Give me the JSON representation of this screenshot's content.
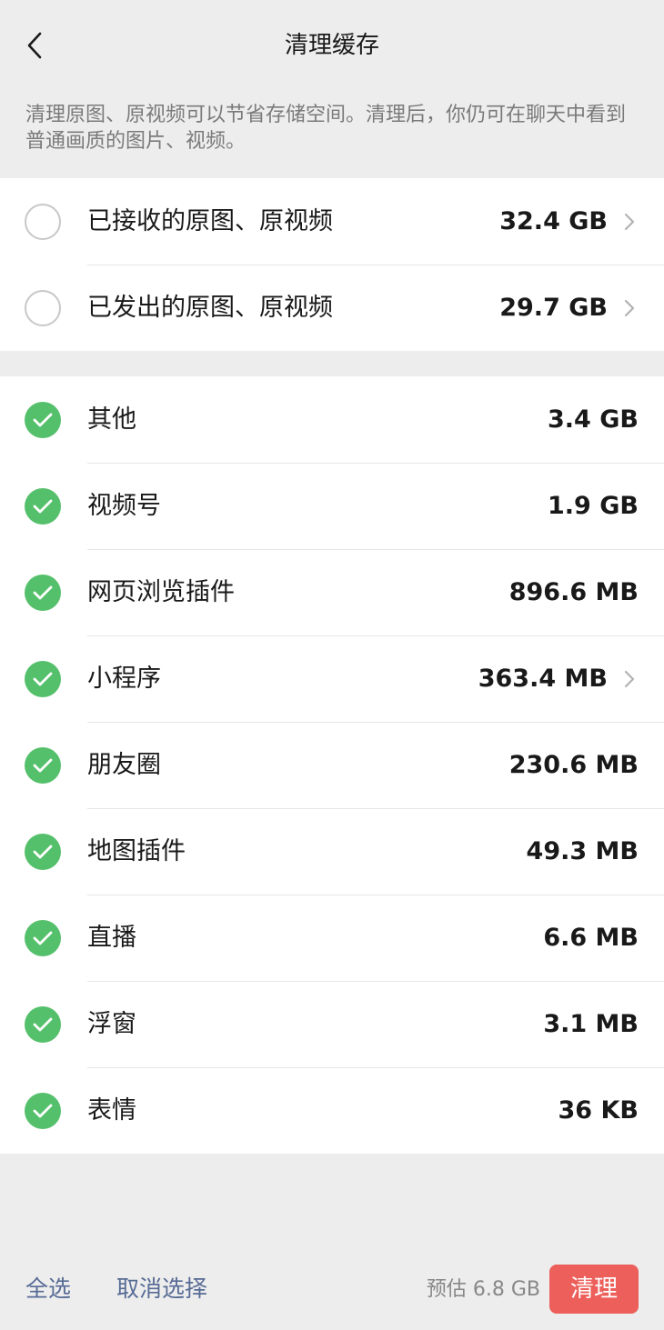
{
  "header": {
    "title": "清理缓存",
    "back_icon": "chevron-left-icon"
  },
  "description": "清理原图、原视频可以节省存储空间。清理后，你仍可在聊天中看到普通画质的图片、视频。",
  "colors": {
    "background": "#ededed",
    "card": "#ffffff",
    "check_green": "#55c06b",
    "link_blue": "#576b95",
    "clean_red": "#ec5f5a"
  },
  "media_items": [
    {
      "label": "已接收的原图、原视频",
      "size": "32.4 GB",
      "checked": false,
      "has_arrow": true
    },
    {
      "label": "已发出的原图、原视频",
      "size": "29.7 GB",
      "checked": false,
      "has_arrow": true
    }
  ],
  "cache_items": [
    {
      "label": "其他",
      "size": "3.4 GB",
      "checked": true,
      "has_arrow": false
    },
    {
      "label": "视频号",
      "size": "1.9 GB",
      "checked": true,
      "has_arrow": false
    },
    {
      "label": "网页浏览插件",
      "size": "896.6 MB",
      "checked": true,
      "has_arrow": false
    },
    {
      "label": "小程序",
      "size": "363.4 MB",
      "checked": true,
      "has_arrow": true
    },
    {
      "label": "朋友圈",
      "size": "230.6 MB",
      "checked": true,
      "has_arrow": false
    },
    {
      "label": "地图插件",
      "size": "49.3 MB",
      "checked": true,
      "has_arrow": false
    },
    {
      "label": "直播",
      "size": "6.6 MB",
      "checked": true,
      "has_arrow": false
    },
    {
      "label": "浮窗",
      "size": "3.1 MB",
      "checked": true,
      "has_arrow": false
    },
    {
      "label": "表情",
      "size": "36 KB",
      "checked": true,
      "has_arrow": false
    }
  ],
  "footer": {
    "select_all": "全选",
    "cancel_selection": "取消选择",
    "estimate": "预估 6.8 GB",
    "clean_button": "清理"
  }
}
